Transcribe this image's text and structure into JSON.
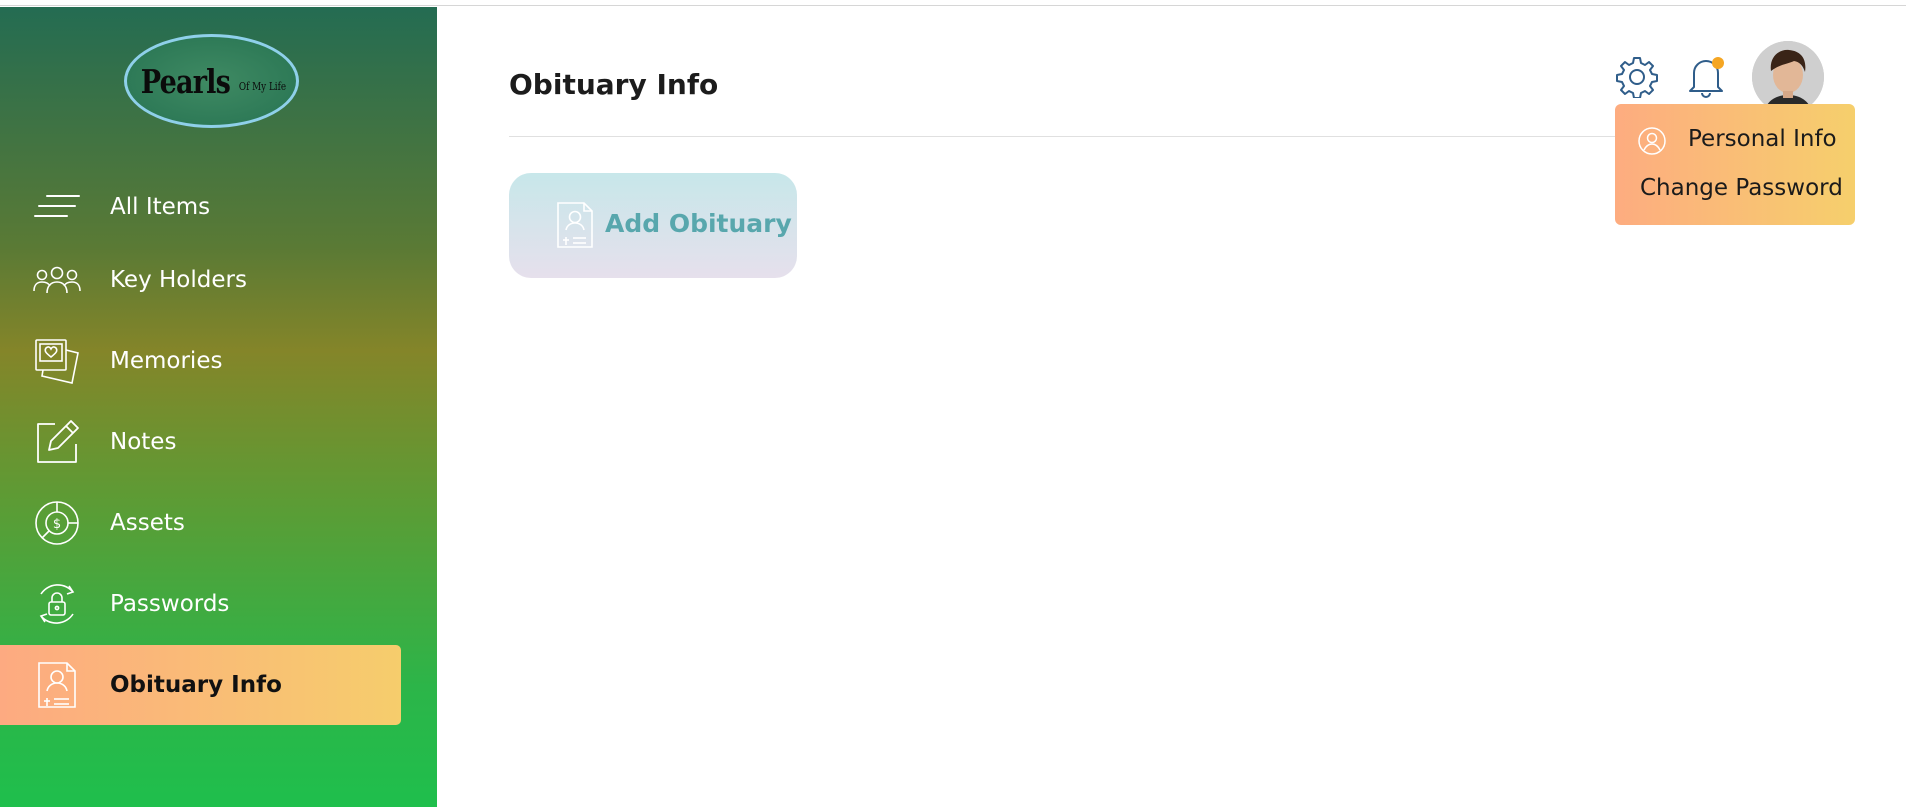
{
  "logo": {
    "main": "Pearls",
    "sub": "Of My Life"
  },
  "sidebar": {
    "items": [
      {
        "label": "All Items",
        "icon": "menu-lines-icon"
      },
      {
        "label": "Key Holders",
        "icon": "people-group-icon"
      },
      {
        "label": "Memories",
        "icon": "photo-heart-icon"
      },
      {
        "label": "Notes",
        "icon": "edit-note-icon"
      },
      {
        "label": "Assets",
        "icon": "dollar-chart-icon"
      },
      {
        "label": "Passwords",
        "icon": "lock-refresh-icon"
      },
      {
        "label": "Obituary Info",
        "icon": "obituary-document-icon",
        "active": true
      }
    ]
  },
  "header": {
    "title": "Obituary Info",
    "icons": [
      "gear-icon",
      "bell-icon"
    ],
    "notification_dot_color": "#f5a623"
  },
  "main": {
    "add_button_label": "Add Obituary"
  },
  "dropdown": {
    "items": [
      {
        "label": "Personal Info",
        "icon": "user-circle-icon"
      },
      {
        "label": "Change Password"
      }
    ]
  },
  "colors": {
    "accent_gradient_start": "#fdaa81",
    "accent_gradient_end": "#f6cd6c",
    "header_icon": "#2f5d8a",
    "add_button_text": "#58a7ad"
  }
}
